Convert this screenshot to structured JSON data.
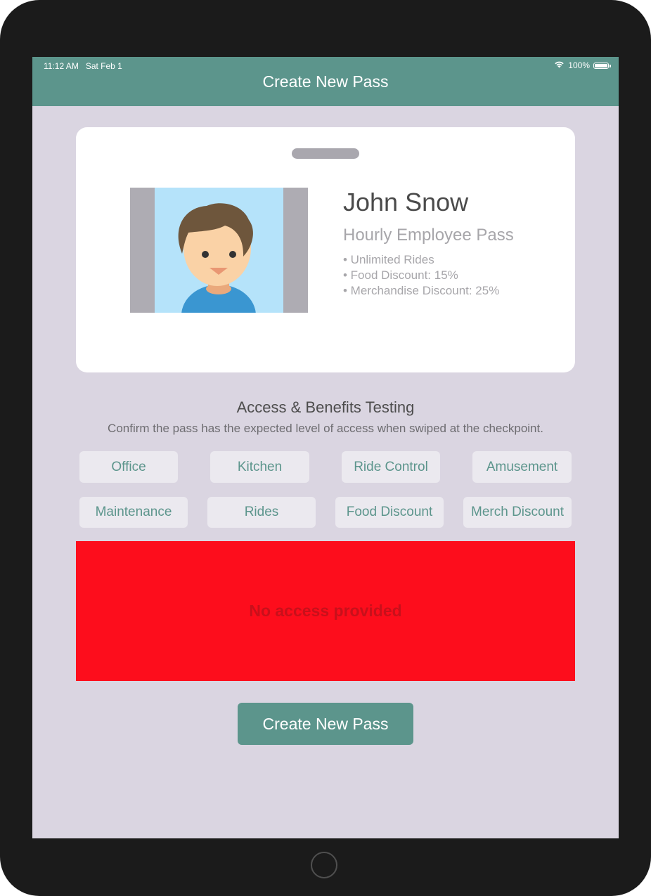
{
  "status_bar": {
    "time": "11:12 AM",
    "date": "Sat Feb 1",
    "battery": "100%",
    "battery_level": 1.0,
    "wifi_icon": "wifi-icon",
    "battery_icon": "battery-icon"
  },
  "navbar": {
    "title": "Create New Pass"
  },
  "pass": {
    "name": "John Snow",
    "type": "Hourly Employee Pass",
    "benefits": [
      "• Unlimited Rides",
      "•  Food Discount: 15%",
      "•  Merchandise Discount: 25%"
    ],
    "photo_icon": "person-avatar-icon"
  },
  "testing": {
    "title": "Access & Benefits Testing",
    "subtitle": "Confirm the pass has the expected level of access when swiped at the checkpoint.",
    "buttons_row1": [
      "Office",
      "Kitchen",
      "Ride Control",
      "Amusement"
    ],
    "buttons_row2": [
      "Maintenance",
      "Rides",
      "Food Discount",
      "Merch Discount"
    ]
  },
  "result": {
    "message": "No access provided",
    "color": "#fd0d1c"
  },
  "create_button": {
    "label": "Create New Pass"
  },
  "colors": {
    "accent": "#5c958c",
    "background": "#dad5e1",
    "button_bg": "#ebe9ef"
  }
}
